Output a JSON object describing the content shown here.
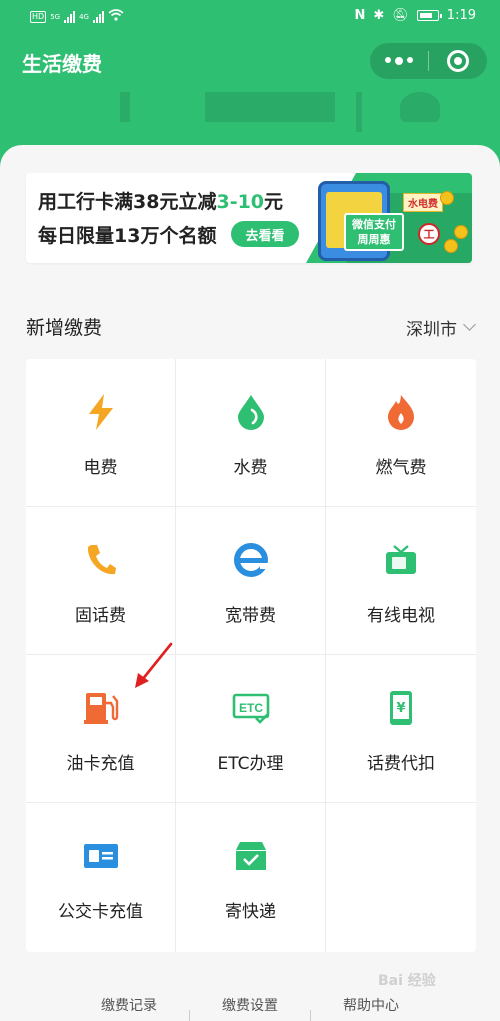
{
  "status_bar": {
    "left_badge": "HD",
    "net1": "5G",
    "net2": "4G",
    "time": "1:19"
  },
  "header": {
    "title": "生活缴费"
  },
  "banner": {
    "line1_a": "用工行卡满",
    "line1_b": "38元立减",
    "line1_highlight": "3-10",
    "line1_c": "元",
    "line2": "每日限量13万个名额",
    "button": "去看看",
    "art_tag": "水电费",
    "art_label1": "微信支付",
    "art_label2": "周周惠",
    "art_bank": "ICBC"
  },
  "section": {
    "title": "新增缴费",
    "city": "深圳市"
  },
  "services": [
    {
      "label": "电费",
      "icon": "lightning-icon",
      "color": "#f5a623"
    },
    {
      "label": "水费",
      "icon": "water-drop-icon",
      "color": "#2fbf73"
    },
    {
      "label": "燃气费",
      "icon": "flame-icon",
      "color": "#f06a35"
    },
    {
      "label": "固话费",
      "icon": "phone-icon",
      "color": "#f5a623"
    },
    {
      "label": "宽带费",
      "icon": "broadband-e-icon",
      "color": "#2b8fe0"
    },
    {
      "label": "有线电视",
      "icon": "tv-icon",
      "color": "#2fbf73"
    },
    {
      "label": "油卡充值",
      "icon": "gas-pump-icon",
      "color": "#f06a35"
    },
    {
      "label": "ETC办理",
      "icon": "etc-icon",
      "color": "#2fbf73"
    },
    {
      "label": "话费代扣",
      "icon": "mobile-yen-icon",
      "color": "#2fbf73"
    },
    {
      "label": "公交卡充值",
      "icon": "bus-card-icon",
      "color": "#2b8fe0"
    },
    {
      "label": "寄快递",
      "icon": "parcel-icon",
      "color": "#2fbf73"
    }
  ],
  "footer": {
    "items": [
      "缴费记录",
      "缴费设置",
      "帮助中心"
    ]
  },
  "watermark": "Bai 经验",
  "colors": {
    "brand_green": "#2fbf73",
    "annotation_arrow": "#e02020"
  }
}
